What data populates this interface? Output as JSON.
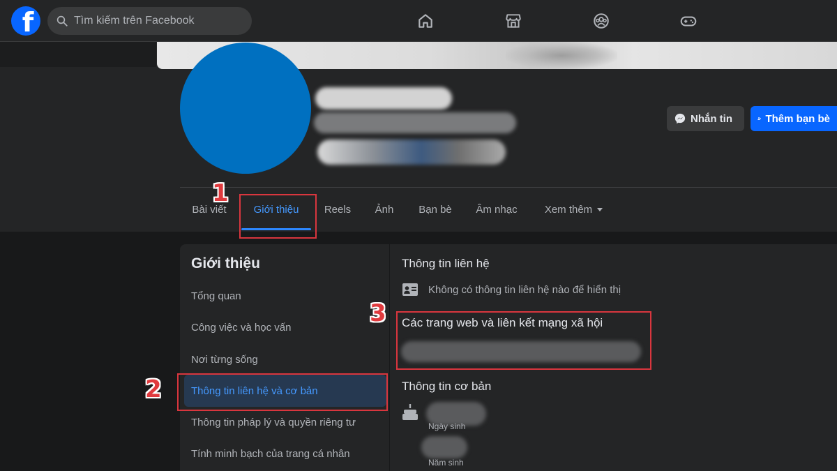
{
  "search": {
    "placeholder": "Tìm kiếm trên Facebook"
  },
  "nav_icons": [
    "home-icon",
    "marketplace-icon",
    "groups-icon",
    "gaming-icon"
  ],
  "actions": {
    "message_label": "Nhắn tin",
    "add_friend_label": "Thêm bạn bè"
  },
  "tabs": [
    "Bài viết",
    "Giới thiệu",
    "Reels",
    "Ảnh",
    "Bạn bè",
    "Âm nhạc",
    "Xem thêm"
  ],
  "active_tab": "Giới thiệu",
  "about": {
    "title": "Giới thiệu",
    "menu": [
      "Tổng quan",
      "Công việc và học vấn",
      "Nơi từng sống",
      "Thông tin liên hệ và cơ bản",
      "Thông tin pháp lý và quyền riêng tư",
      "Tính minh bạch của trang cá nhân"
    ],
    "active_menu": "Thông tin liên hệ và cơ bản"
  },
  "contact": {
    "title": "Thông tin liên hệ",
    "empty_text": "Không có thông tin liên hệ nào để hiển thị",
    "websites_title": "Các trang web và liên kết mạng xã hội",
    "basic_title": "Thông tin cơ bản",
    "birthday_label": "Ngày sinh",
    "birthyear_label": "Năm sinh"
  },
  "annotations": [
    "1",
    "2",
    "3"
  ],
  "colors": {
    "accent": "#2d88ff",
    "brand": "#0866ff",
    "avatar": "#0070c0",
    "annotation": "#d9363e"
  }
}
